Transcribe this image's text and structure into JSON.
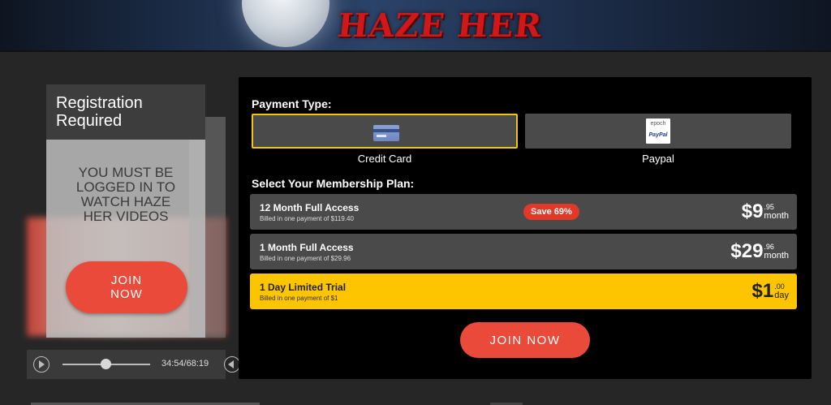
{
  "header": {
    "brand": "HAZE HER"
  },
  "player": {
    "registration_title": "Registration\nRequired",
    "message": "You must be logged in to watch Haze Her videos",
    "join_label": "JOIN\nNOW",
    "time": "34:54/68:19",
    "seek_progress": 0.511,
    "volume_level": 1.0
  },
  "payment": {
    "type_label": "Payment Type:",
    "options": [
      {
        "label": "Credit Card",
        "icon": "credit-card-icon",
        "selected": true
      },
      {
        "label": "Paypal",
        "icon": "epoch-paypal-icon",
        "icon_text": "epoch",
        "icon_sub": "PayPal",
        "selected": false
      }
    ]
  },
  "plans": {
    "label": "Select Your Membership Plan:",
    "items": [
      {
        "name": "12 Month Full Access",
        "billing": "Billed in one payment of $119.40",
        "badge": "Save 69%",
        "price_main": "$9",
        "price_cents": ".95",
        "price_unit": "month",
        "highlight": false
      },
      {
        "name": "1 Month Full Access",
        "billing": "Billed in one payment of $29.96",
        "badge": "",
        "price_main": "$29",
        "price_cents": ".96",
        "price_unit": "month",
        "highlight": false
      },
      {
        "name": "1 Day Limited Trial",
        "billing": "Billed in one payment of $1",
        "badge": "",
        "price_main": "$1",
        "price_cents": ".00",
        "price_unit": "day",
        "highlight": true
      }
    ]
  },
  "cta": {
    "join_label": "JOIN NOW"
  },
  "colors": {
    "accent_red": "#ea4a3a",
    "highlight_yellow": "#fdc500",
    "selected_border": "#f1c40f"
  }
}
